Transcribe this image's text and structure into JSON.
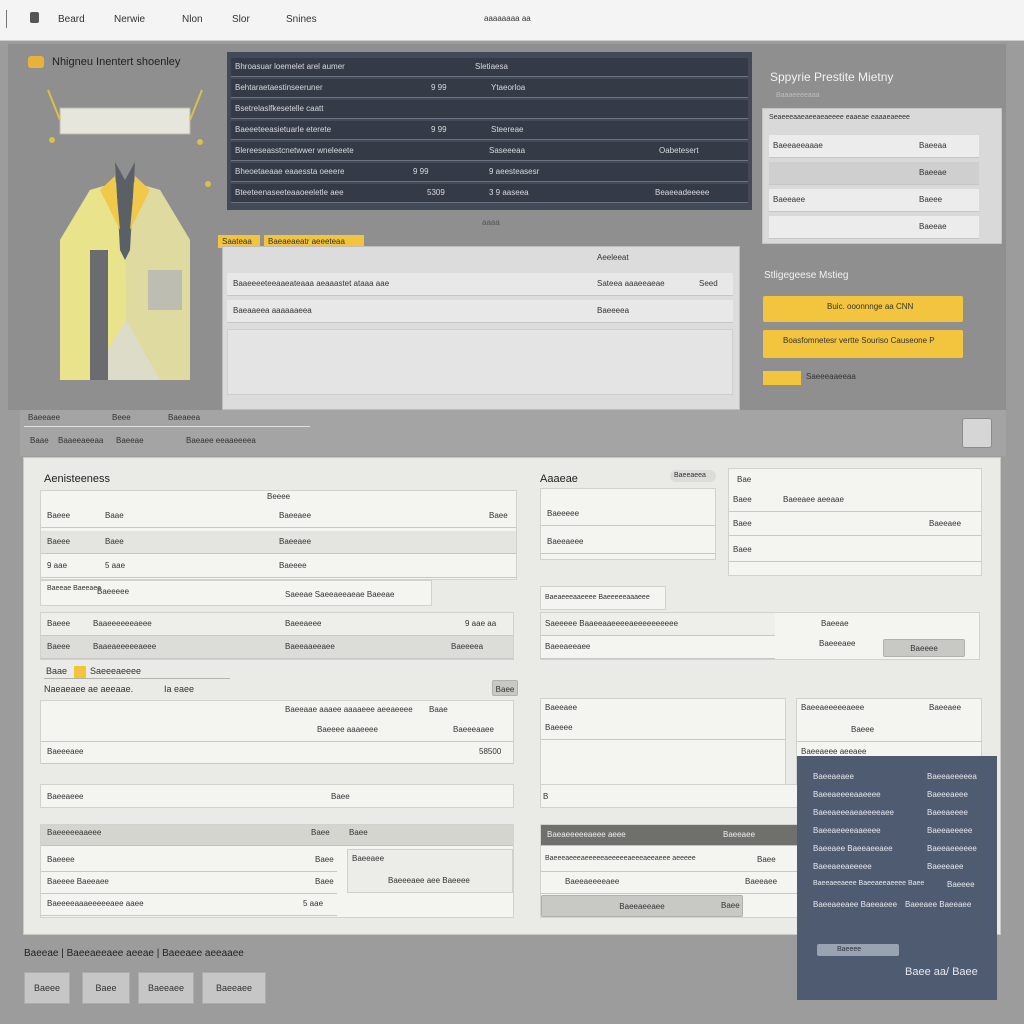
{
  "topbar": {
    "nav": [
      "Beard",
      "Nerwie",
      "Nlon",
      "Slor",
      "Snines"
    ],
    "center": "aaaaaaaa aa"
  },
  "product": {
    "title": "Nhigneu Inentert shoenley",
    "illustration": "jacket-illustration"
  },
  "dark_table": {
    "rows": [
      [
        "Bhroasuar loemelet arel aumer",
        "Sletiaesa",
        "",
        ""
      ],
      [
        "Behtaraetaestinseeruner",
        "9 99",
        "Ytaeorloa",
        ""
      ],
      [
        "Bsetrelaslfkesetelle caatt",
        "",
        "",
        ""
      ],
      [
        "Baeeeteeasietuarle eterete",
        "9 99",
        "Steereae",
        ""
      ],
      [
        "Blereeseasstcnetwwer wneleeete",
        "",
        "Saseeeaa",
        "Oabetesert"
      ],
      [
        "Bheoetaeaae eaaessta oeeere",
        "9 99",
        "9 aeesteasesr",
        ""
      ],
      [
        "Bteeteenaseeteaaoeeletle aee",
        "5309",
        "3 9 aaseea",
        "Beaeeadeeeee"
      ]
    ],
    "caption": "aaaa"
  },
  "tags": [
    "Saateaa",
    "Baeaeaeatr aeeeteaa"
  ],
  "grey_table": {
    "head": "Aeeleeat",
    "rows": [
      [
        "Baaeeeeteeaaeateaaa aeaaastet ataaa aae",
        "Sateea aaaeeaeae",
        "Seed"
      ],
      [
        "Baeaaeea  aaaaaaeea",
        "Baeeeea",
        ""
      ]
    ]
  },
  "sidebar": {
    "title": "Sppyrie Prestite Mietny",
    "sub": "Baaaeeeeaaa",
    "mini_head": "Seaeeeaaeaeeaeaeeee  eaaeae  eaaaeaeeee",
    "mini_rows": [
      [
        "Baeeaeeaaae",
        "Baeeaa"
      ],
      [
        "",
        "Baeeae"
      ],
      [
        "Baeeaee",
        "Baeee"
      ],
      [
        "",
        "Baeeae"
      ]
    ],
    "section_title": "Stligegeese Mstieg",
    "btn1": "Buic. ooonnnge  aa  CNN",
    "btn2": "Boasfomnetesr vertte Souriso Causeone P",
    "link": "Saeeeaaeeaa"
  },
  "toolbar": {
    "items": [
      "Baeeaee",
      "Beee",
      "Baeaeea"
    ],
    "sub": [
      "Baae",
      "Baaeeaeeaa",
      "Baeeae",
      "Baeaee eeaaeeeea"
    ]
  },
  "main": {
    "left_title": "Aenisteeness",
    "left_head": "Beeee",
    "left_rows": [
      [
        "Baeee",
        "Baae",
        "Baeeaee",
        "Baee"
      ],
      [
        "Baeee",
        "Baee",
        "Baeeaee",
        ""
      ],
      [
        "9 aae",
        "5 aae",
        "Baeeee",
        ""
      ]
    ],
    "s2_left": "Baeeae Baeeaee",
    "s2_label": "Baeeeee",
    "s2_title": "Saeeae  Saeeaeeaeae Baeeae",
    "s2_rows": [
      [
        "Baeee",
        "Baaeeeeeeaeee",
        "Baeeaeee",
        "9 aae aa"
      ],
      [
        "Baeee",
        "Baaeaeeeeeaeee",
        "Baeeaaeeaee",
        "Baeeeea"
      ]
    ],
    "s3_tag": "Baae",
    "s3_title": "Saeeeaeeee",
    "s3_sub": "Naeaeaee ae aeeaae.",
    "s3_val": "Ia eaee",
    "s3_btn": "Baee",
    "s3_head": [
      "Baeeaae aaaee aaaaeee aeeaeeee",
      "Baae"
    ],
    "s3_rows": [
      [
        "Baeeeee",
        "Baeeee aaaeeee",
        "Baeeeaaee"
      ],
      [
        "Baeeeaee",
        "",
        "58500"
      ]
    ],
    "s4_left": "Baeeaeee",
    "s4_right": "Baee",
    "s5_head": [
      "Baeeeeeaaeee",
      "Baee",
      "Baee"
    ],
    "s5_rows": [
      [
        "Baeeee",
        "Baee",
        "Baeeaee"
      ],
      [
        "Baeeee  Baeeaee",
        "Baee",
        "Baeeeaee aee Baeeee"
      ],
      [
        "Baeeeeaaaeeeeeaee aaee",
        "5 aae",
        ""
      ]
    ],
    "right_title": "Aaaeae",
    "right_badge": "Baeeaeea",
    "right_small": "Bae",
    "r_rows": [
      [
        "Baeeeee",
        "Baee",
        "Baeeaee aeeaae"
      ],
      [
        "Baeeaeee",
        "Baee",
        "Baeeaee"
      ],
      [
        "Baeeeee",
        "Baee",
        "Baee"
      ]
    ],
    "r2_title": "Baeaeeeaaeeee Baeeeeeaaaeee",
    "r2_rows": [
      [
        "Saeeeee Baaeeaaeeeeaeeeeeeeeee",
        "Baeeae",
        ""
      ],
      [
        "Baeeaeeaee",
        "Baeeeaee",
        "Baeeaee"
      ]
    ],
    "r2_btn": "Baeeee",
    "r3_title": "Baeeaee",
    "r3_head": [
      "Baeeaeeeeeaeee",
      "Baeeaee"
    ],
    "r3_rows": [
      [
        "Baeeee",
        "Baeee"
      ],
      [
        "Baeeaeee aeeaee",
        ""
      ]
    ],
    "r4_left": "B",
    "r5_head": [
      "Baeaeeeeeaeee aeee",
      "Baeeaee"
    ],
    "r5_rows": [
      [
        "Baeeeaeeeaeeeeeaeeeeeaeeeaeeaeee aeeeee",
        "Baee"
      ],
      [
        "Baeeaeeeeaee",
        "Baeeaee"
      ]
    ],
    "r5_btn": [
      "Baeeaeeaee",
      "Baee"
    ]
  },
  "dark_card": {
    "rows": [
      [
        "Baeeaeaee",
        "Baeeaeeeeea"
      ],
      [
        "Baeeaeeeeaaeeee",
        "Baeeeaeee"
      ],
      [
        "Baeeaeeeaeaeeeeaee",
        "Baeeaeeee"
      ],
      [
        "Baeeaeeeeaaeeee",
        "Baeeaeeeee"
      ],
      [
        "Baeeaee Baeeaeeaee",
        "Baeeaeeeeee"
      ],
      [
        "Baeeaeeaeeeee",
        "Baeeeaee"
      ],
      [
        "Baeeaeeaeee Baeeaeeaeeee Baee",
        "Baeeee"
      ],
      [
        "Baeeaeeaee Baeeaeee",
        "Baeeaee Baeeaee"
      ]
    ],
    "btn": "Baeeee",
    "pager": "Baee aa/ Baee"
  },
  "footer": {
    "breadcrumb": "Baeeae  |  Baeeaeeaee aeeae  |  Baeeaee aeeaaee",
    "buttons": [
      "Baeee",
      "Baee",
      "Baeeaee",
      "Baeeaee"
    ]
  }
}
